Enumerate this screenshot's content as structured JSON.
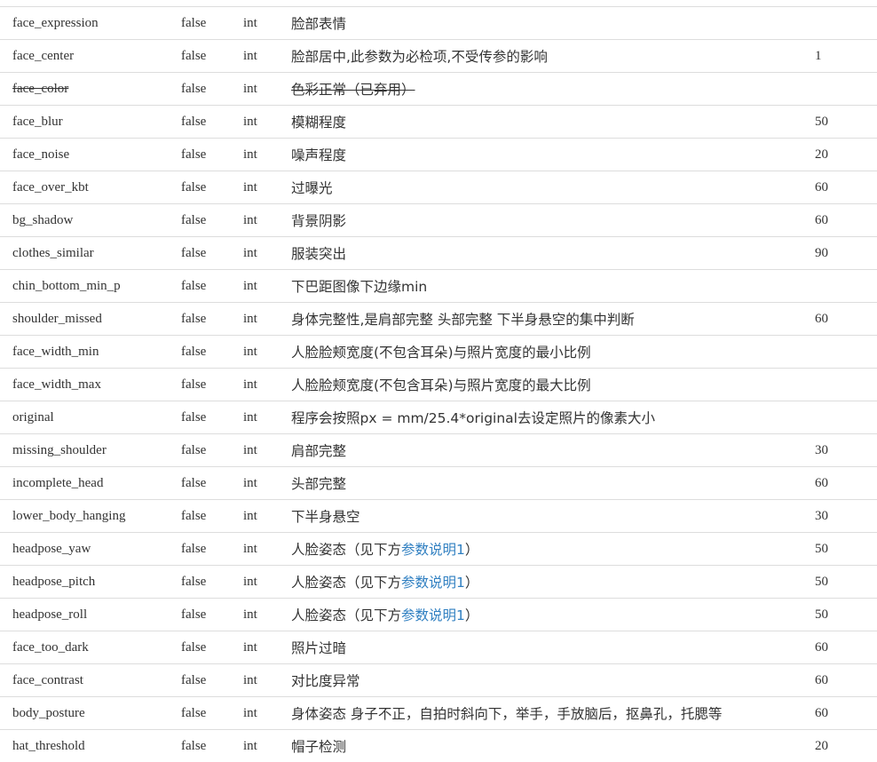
{
  "rows": [
    {
      "name": "face_expression",
      "required": "false",
      "type": "int",
      "desc": "脸部表情",
      "link": "",
      "desc_after": "",
      "default": "",
      "deprecated": false
    },
    {
      "name": "face_center",
      "required": "false",
      "type": "int",
      "desc": "脸部居中,此参数为必检项,不受传参的影响",
      "link": "",
      "desc_after": "",
      "default": "1",
      "deprecated": false
    },
    {
      "name": "face_color",
      "required": "false",
      "type": "int",
      "desc": "色彩正常（已弃用）",
      "link": "",
      "desc_after": "",
      "default": "",
      "deprecated": true
    },
    {
      "name": "face_blur",
      "required": "false",
      "type": "int",
      "desc": "模糊程度",
      "link": "",
      "desc_after": "",
      "default": "50",
      "deprecated": false
    },
    {
      "name": "face_noise",
      "required": "false",
      "type": "int",
      "desc": "噪声程度",
      "link": "",
      "desc_after": "",
      "default": "20",
      "deprecated": false
    },
    {
      "name": "face_over_kbt",
      "required": "false",
      "type": "int",
      "desc": "过曝光",
      "link": "",
      "desc_after": "",
      "default": "60",
      "deprecated": false
    },
    {
      "name": "bg_shadow",
      "required": "false",
      "type": "int",
      "desc": "背景阴影",
      "link": "",
      "desc_after": "",
      "default": "60",
      "deprecated": false
    },
    {
      "name": "clothes_similar",
      "required": "false",
      "type": "int",
      "desc": "服装突出",
      "link": "",
      "desc_after": "",
      "default": "90",
      "deprecated": false
    },
    {
      "name": "chin_bottom_min_p",
      "required": "false",
      "type": "int",
      "desc": "下巴距图像下边缘min",
      "link": "",
      "desc_after": "",
      "default": "",
      "deprecated": false
    },
    {
      "name": "shoulder_missed",
      "required": "false",
      "type": "int",
      "desc": "身体完整性,是肩部完整 头部完整 下半身悬空的集中判断",
      "link": "",
      "desc_after": "",
      "default": "60",
      "deprecated": false
    },
    {
      "name": "face_width_min",
      "required": "false",
      "type": "int",
      "desc": "人脸脸颊宽度(不包含耳朵)与照片宽度的最小比例",
      "link": "",
      "desc_after": "",
      "default": "",
      "deprecated": false
    },
    {
      "name": "face_width_max",
      "required": "false",
      "type": "int",
      "desc": "人脸脸颊宽度(不包含耳朵)与照片宽度的最大比例",
      "link": "",
      "desc_after": "",
      "default": "",
      "deprecated": false
    },
    {
      "name": "original",
      "required": "false",
      "type": "int",
      "desc": "程序会按照px = mm/25.4*original去设定照片的像素大小",
      "link": "",
      "desc_after": "",
      "default": "",
      "deprecated": false
    },
    {
      "name": "missing_shoulder",
      "required": "false",
      "type": "int",
      "desc": "肩部完整",
      "link": "",
      "desc_after": "",
      "default": "30",
      "deprecated": false
    },
    {
      "name": "incomplete_head",
      "required": "false",
      "type": "int",
      "desc": "头部完整",
      "link": "",
      "desc_after": "",
      "default": "60",
      "deprecated": false
    },
    {
      "name": "lower_body_hanging",
      "required": "false",
      "type": "int",
      "desc": "下半身悬空",
      "link": "",
      "desc_after": "",
      "default": "30",
      "deprecated": false
    },
    {
      "name": "headpose_yaw",
      "required": "false",
      "type": "int",
      "desc": "人脸姿态（见下方",
      "link": "参数说明1",
      "desc_after": "）",
      "default": "50",
      "deprecated": false
    },
    {
      "name": "headpose_pitch",
      "required": "false",
      "type": "int",
      "desc": "人脸姿态（见下方",
      "link": "参数说明1",
      "desc_after": "）",
      "default": "50",
      "deprecated": false
    },
    {
      "name": "headpose_roll",
      "required": "false",
      "type": "int",
      "desc": "人脸姿态（见下方",
      "link": "参数说明1",
      "desc_after": "）",
      "default": "50",
      "deprecated": false
    },
    {
      "name": "face_too_dark",
      "required": "false",
      "type": "int",
      "desc": "照片过暗",
      "link": "",
      "desc_after": "",
      "default": "60",
      "deprecated": false
    },
    {
      "name": "face_contrast",
      "required": "false",
      "type": "int",
      "desc": "对比度异常",
      "link": "",
      "desc_after": "",
      "default": "60",
      "deprecated": false
    },
    {
      "name": "body_posture",
      "required": "false",
      "type": "int",
      "desc": "身体姿态 身子不正，自拍时斜向下，举手，手放脑后，抠鼻孔，托腮等",
      "link": "",
      "desc_after": "",
      "default": "60",
      "deprecated": false
    },
    {
      "name": "hat_threshold",
      "required": "false",
      "type": "int",
      "desc": "帽子检测",
      "link": "",
      "desc_after": "",
      "default": "20",
      "deprecated": false
    }
  ],
  "colors": {
    "text": "#333333",
    "link": "#2f7fc1",
    "border": "#dddddd"
  }
}
